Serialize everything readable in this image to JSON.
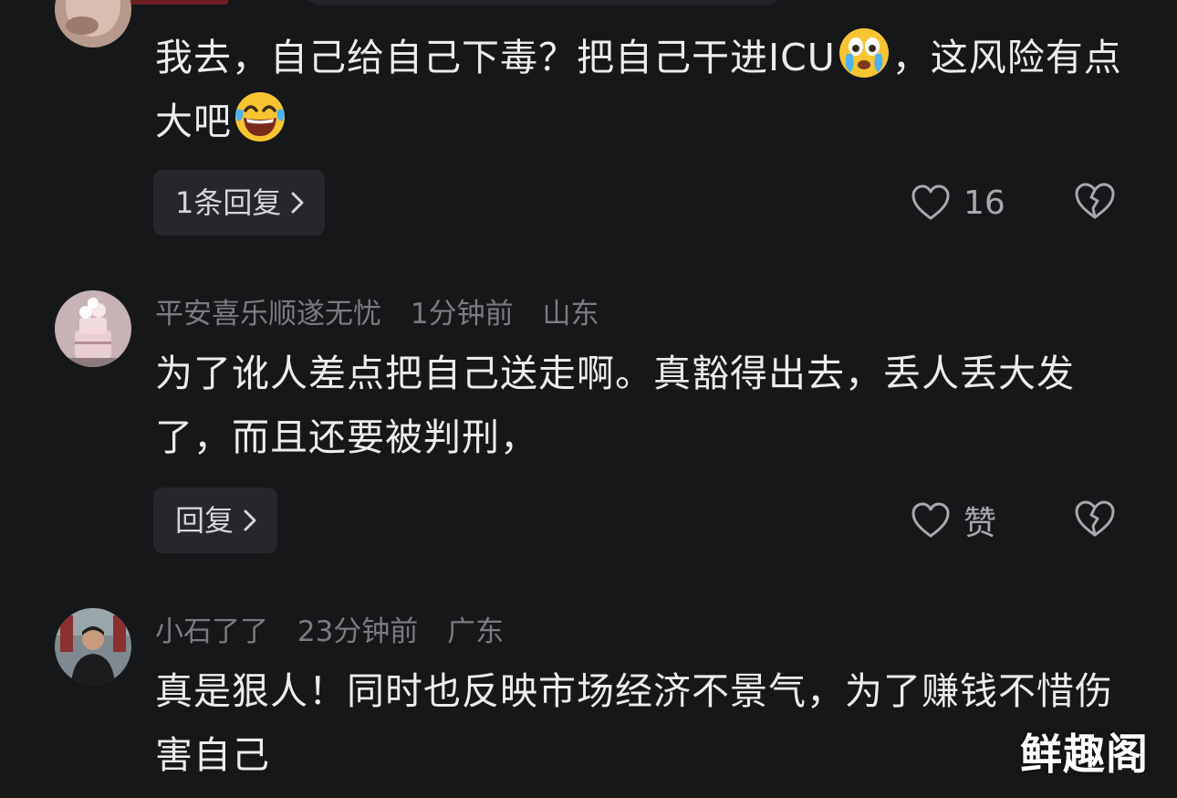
{
  "comments": [
    {
      "text_part1": "我去，自己给自己下毒？把自己干进ICU",
      "emoji1": "crying-face-emoji",
      "text_part2": "，这风险有点大吧",
      "emoji2": "laughing-tears-emoji",
      "reply_label": "1条回复",
      "like_count": "16"
    },
    {
      "username": "平安喜乐顺遂无忧",
      "time": "1分钟前",
      "location": "山东",
      "text": "为了讹人差点把自己送走啊。真豁得出去，丢人丢大发了，而且还要被判刑，",
      "reply_label": "回复",
      "like_label": "赞"
    },
    {
      "username": "小石了了",
      "time": "23分钟前",
      "location": "广东",
      "text": "真是狠人！同时也反映市场经济不景气，为了赚钱不惜伤害自己"
    }
  ],
  "icons": {
    "reply_chevron": "chevron-right-icon",
    "like": "heart-outline-icon",
    "dislike": "broken-heart-icon"
  },
  "colors": {
    "background": "#161719",
    "text": "#ececed",
    "meta": "#7b7c80",
    "button_bg": "#26272b"
  },
  "watermark": "鲜趣阁"
}
